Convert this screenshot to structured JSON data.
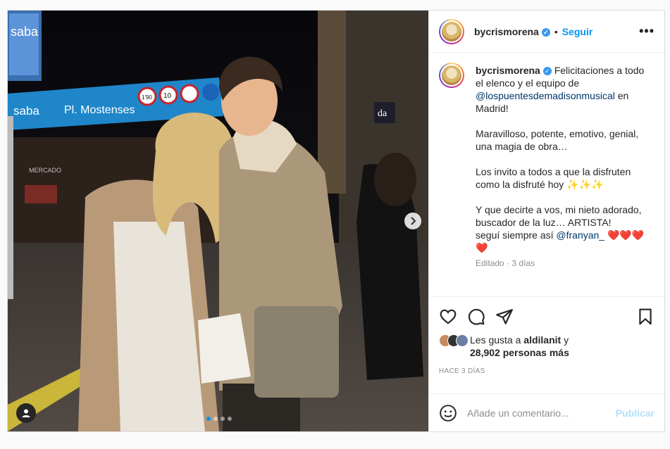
{
  "header": {
    "username": "bycrismorena",
    "verified_icon": "verified-badge-icon",
    "separator": "•",
    "follow_label": "Seguir",
    "more_icon": "more-options-icon"
  },
  "caption": {
    "username": "bycrismorena",
    "text_1": " Felicitaciones a todo el elenco y el equipo de ",
    "mention_1": "@lospuentesdemadisonmusical",
    "text_2": " en Madrid!\n\nMaravilloso, potente, emotivo, genial, una magia de obra…\n\nLos invito a todos a que la disfruten como la disfruté hoy ✨✨✨\n\nY que decirte a vos, mi nieto adorado, buscador de la luz… ARTISTA!\nseguí siempre así ",
    "mention_2": "@franyan_",
    "text_3": " ❤️❤️❤️❤️",
    "edited": "Editado",
    "dot": "·",
    "ago": "3 días"
  },
  "media": {
    "signs": {
      "parking_brand": "saba",
      "street": "Pl. Mostenses",
      "sign_speed_1": "1'90",
      "sign_speed_2": "10",
      "market": "MERCADO",
      "shop": "da"
    },
    "pager_total": 4,
    "pager_active": 1
  },
  "actions": {
    "like_icon": "heart-icon",
    "comment_icon": "comment-icon",
    "share_icon": "share-icon",
    "save_icon": "bookmark-icon"
  },
  "likes": {
    "prefix": "Les gusta a ",
    "user": "aldilanit",
    "connector": " y",
    "count": "28,902 personas más"
  },
  "timestamp": "HACE 3 DÍAS",
  "comment_box": {
    "emoji_icon": "emoji-icon",
    "placeholder": "Añade un comentario...",
    "publish_label": "Publicar"
  },
  "colors": {
    "accent": "#0095f6",
    "mention": "#00376b",
    "muted": "#8e8e8e"
  }
}
